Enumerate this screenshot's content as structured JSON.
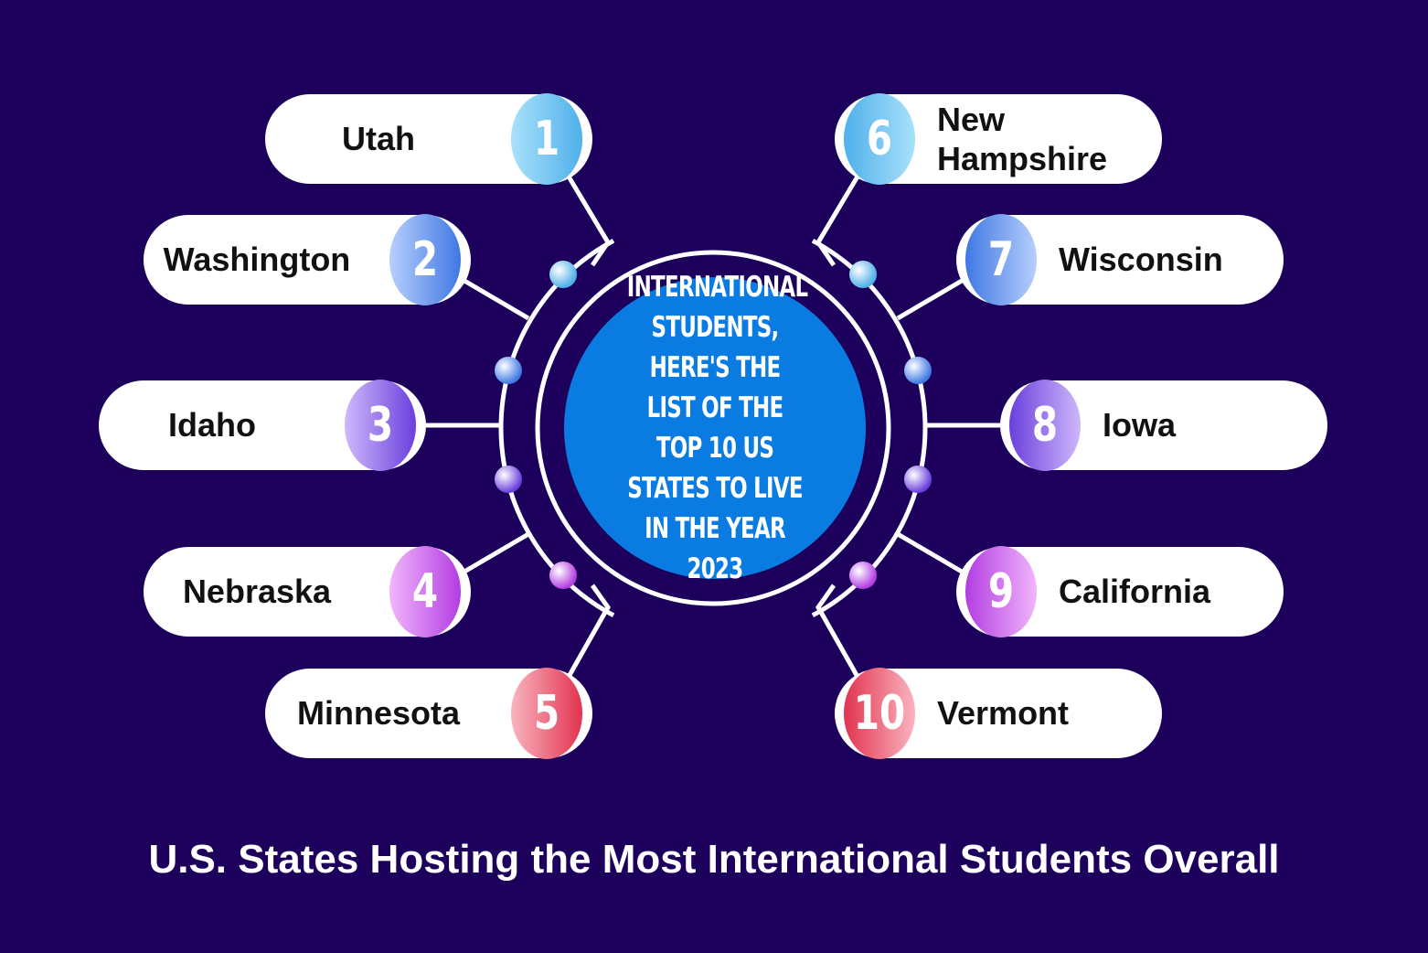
{
  "center_heading": "International Students, here's the list of the top 10 US states to live in the year 2023",
  "footer_title": "U.S. States Hosting the Most International Students Overall",
  "colors": {
    "background": "#1d005c",
    "center": "#0a7be0",
    "ring": "#ffffff"
  },
  "states": [
    {
      "rank": "1",
      "name": "Utah",
      "colors": [
        "#a9e1fb",
        "#4fb0ea"
      ]
    },
    {
      "rank": "2",
      "name": "Washington",
      "colors": [
        "#b7cffd",
        "#3f78e3"
      ]
    },
    {
      "rank": "3",
      "name": "Idaho",
      "colors": [
        "#cfb8fb",
        "#6a3fdd"
      ]
    },
    {
      "rank": "4",
      "name": "Nebraska",
      "colors": [
        "#f1b6fb",
        "#b33de2"
      ]
    },
    {
      "rank": "5",
      "name": "Minnesota",
      "colors": [
        "#f9b5c0",
        "#e2334f"
      ]
    },
    {
      "rank": "6",
      "name": "New Hampshire",
      "colors": [
        "#4fb0ea",
        "#a9e1fb"
      ]
    },
    {
      "rank": "7",
      "name": "Wisconsin",
      "colors": [
        "#3f78e3",
        "#b7cffd"
      ]
    },
    {
      "rank": "8",
      "name": "Iowa",
      "colors": [
        "#6a3fdd",
        "#cfb8fb"
      ]
    },
    {
      "rank": "9",
      "name": "California",
      "colors": [
        "#b33de2",
        "#f1b6fb"
      ]
    },
    {
      "rank": "10",
      "name": "Vermont",
      "colors": [
        "#e2334f",
        "#f9b5c0"
      ]
    }
  ],
  "dot_colors": [
    "#4fb0ea",
    "#3f78e3",
    "#6a3fdd",
    "#b33de2",
    "#4fb0ea",
    "#3f78e3",
    "#6a3fdd",
    "#b33de2"
  ]
}
